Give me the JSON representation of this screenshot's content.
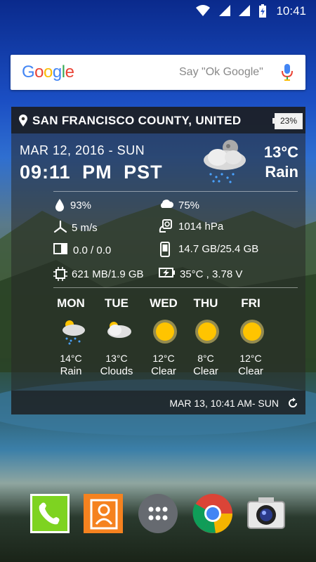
{
  "status_bar": {
    "time": "10:41"
  },
  "search": {
    "logo": "Google",
    "placeholder": "Say \"Ok Google\""
  },
  "widget": {
    "location": "SAN FRANCISCO COUNTY, UNITED",
    "battery": "23%",
    "date": "MAR 12, 2016 - SUN",
    "time": "09:11  PM  PST",
    "current_temp": "13°C",
    "current_condition": "Rain",
    "stats": {
      "humidity": "93%",
      "cloud": "75%",
      "wind": "5  m/s",
      "pressure": "1014 hPa",
      "data_usage": "0.0 / 0.0",
      "storage": "14.7 GB/25.4 GB",
      "memory": "621 MB/1.9 GB",
      "battery_info": "35°C , 3.78 V"
    },
    "forecast": [
      {
        "day": "MON",
        "temp": "14°C",
        "cond": "Rain",
        "icon": "rain-icon"
      },
      {
        "day": "TUE",
        "temp": "13°C",
        "cond": "Clouds",
        "icon": "clouds-icon"
      },
      {
        "day": "WED",
        "temp": "12°C",
        "cond": "Clear",
        "icon": "sun-icon"
      },
      {
        "day": "THU",
        "temp": "8°C",
        "cond": "Clear",
        "icon": "sun-icon"
      },
      {
        "day": "FRI",
        "temp": "12°C",
        "cond": "Clear",
        "icon": "sun-icon"
      }
    ],
    "updated": "MAR 13, 10:41 AM- SUN"
  },
  "dock": [
    "phone-app",
    "contacts-app",
    "app-drawer",
    "chrome-app",
    "camera-app"
  ],
  "colors": {
    "phone": "#7ed321",
    "contacts": "#f5821f",
    "sun": "#ffc400"
  }
}
